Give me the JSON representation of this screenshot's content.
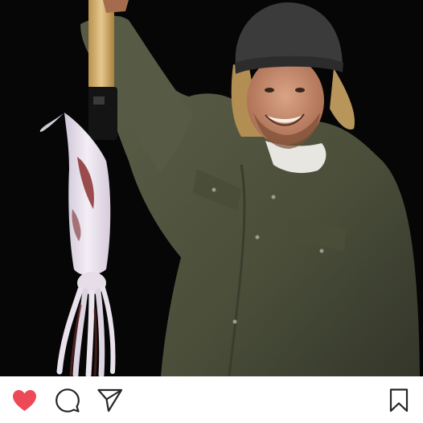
{
  "post": {
    "image": {
      "subject": "photo-man-holding-squid-at-night"
    },
    "actions": {
      "like": {
        "icon": "heart-icon",
        "state": "liked",
        "color": "#ed4956"
      },
      "comment": {
        "icon": "comment-icon"
      },
      "share": {
        "icon": "send-icon"
      },
      "save": {
        "icon": "bookmark-icon"
      }
    }
  },
  "colors": {
    "background": "#ffffff",
    "icon_stroke": "#262626",
    "like_active": "#ed4956"
  }
}
